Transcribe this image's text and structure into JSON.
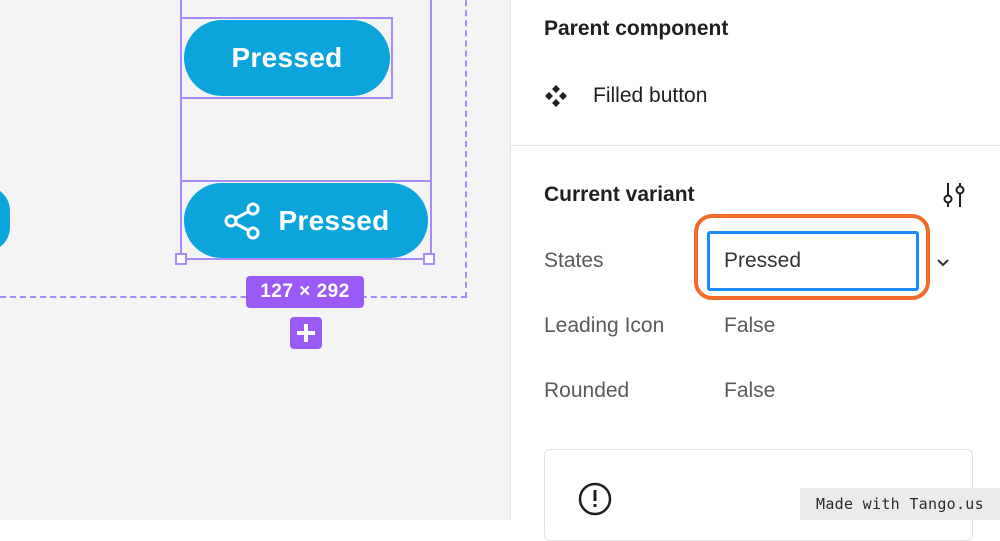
{
  "canvas": {
    "button_pressed_label": "Pressed",
    "button_pressed_share_label": "Pressed",
    "selection_size": "127 × 292",
    "share_icon": "share-icon",
    "add_icon": "plus-icon",
    "button_color": "#0ba5dc",
    "selection_color": "#a78bfa",
    "badge_color": "#9b59f5"
  },
  "panel": {
    "parent_title": "Parent component",
    "parent_component_icon": "component-icon",
    "parent_component_name": "Filled button",
    "variant_title": "Current variant",
    "variant_settings_icon": "tune-icon",
    "properties": {
      "states": {
        "label": "States",
        "value": "Pressed"
      },
      "leading_icon": {
        "label": "Leading Icon",
        "value": "False"
      },
      "rounded": {
        "label": "Rounded",
        "value": "False"
      }
    },
    "highlight_color": "#f26b2a",
    "focus_color": "#1d8cf8",
    "info_icon": "alert-circle-icon"
  },
  "watermark": {
    "text": "Made with Tango.us"
  }
}
